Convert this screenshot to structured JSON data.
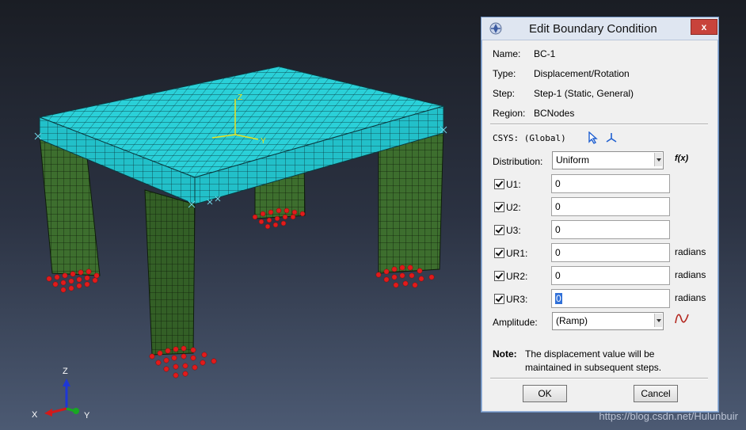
{
  "viewport": {
    "triad_labels": {
      "z": "Z",
      "y": "Y",
      "x": "X"
    },
    "csys_labels": {
      "z": "Z",
      "y": "Y"
    }
  },
  "watermark": "https://blog.csdn.net/Hulunbuir",
  "dialog": {
    "title": "Edit Boundary Condition",
    "close_glyph": "x",
    "info": [
      {
        "label": "Name:",
        "value": "BC-1"
      },
      {
        "label": "Type:",
        "value": "Displacement/Rotation"
      },
      {
        "label": "Step:",
        "value": "Step-1 (Static, General)"
      },
      {
        "label": "Region:",
        "value": "BCNodes"
      }
    ],
    "csys": "CSYS: (Global)",
    "distribution": {
      "label": "Distribution:",
      "value": "Uniform",
      "fx": "f(x)"
    },
    "dofs": [
      {
        "label": "U1:",
        "value": "0",
        "unit": ""
      },
      {
        "label": "U2:",
        "value": "0",
        "unit": ""
      },
      {
        "label": "U3:",
        "value": "0",
        "unit": ""
      },
      {
        "label": "UR1:",
        "value": "0",
        "unit": "radians"
      },
      {
        "label": "UR2:",
        "value": "0",
        "unit": "radians"
      },
      {
        "label": "UR3:",
        "value": "0",
        "unit": "radians"
      }
    ],
    "amplitude": {
      "label": "Amplitude:",
      "value": "(Ramp)"
    },
    "note_label": "Note:",
    "note_text_1": "The displacement value will be",
    "note_text_2": "maintained in subsequent steps.",
    "ok_label": "OK",
    "cancel_label": "Cancel"
  },
  "colors": {
    "mesh_top": "#2ad0d8",
    "mesh_legs": "#3d6e2e",
    "bc_markers": "#e11b1b"
  }
}
